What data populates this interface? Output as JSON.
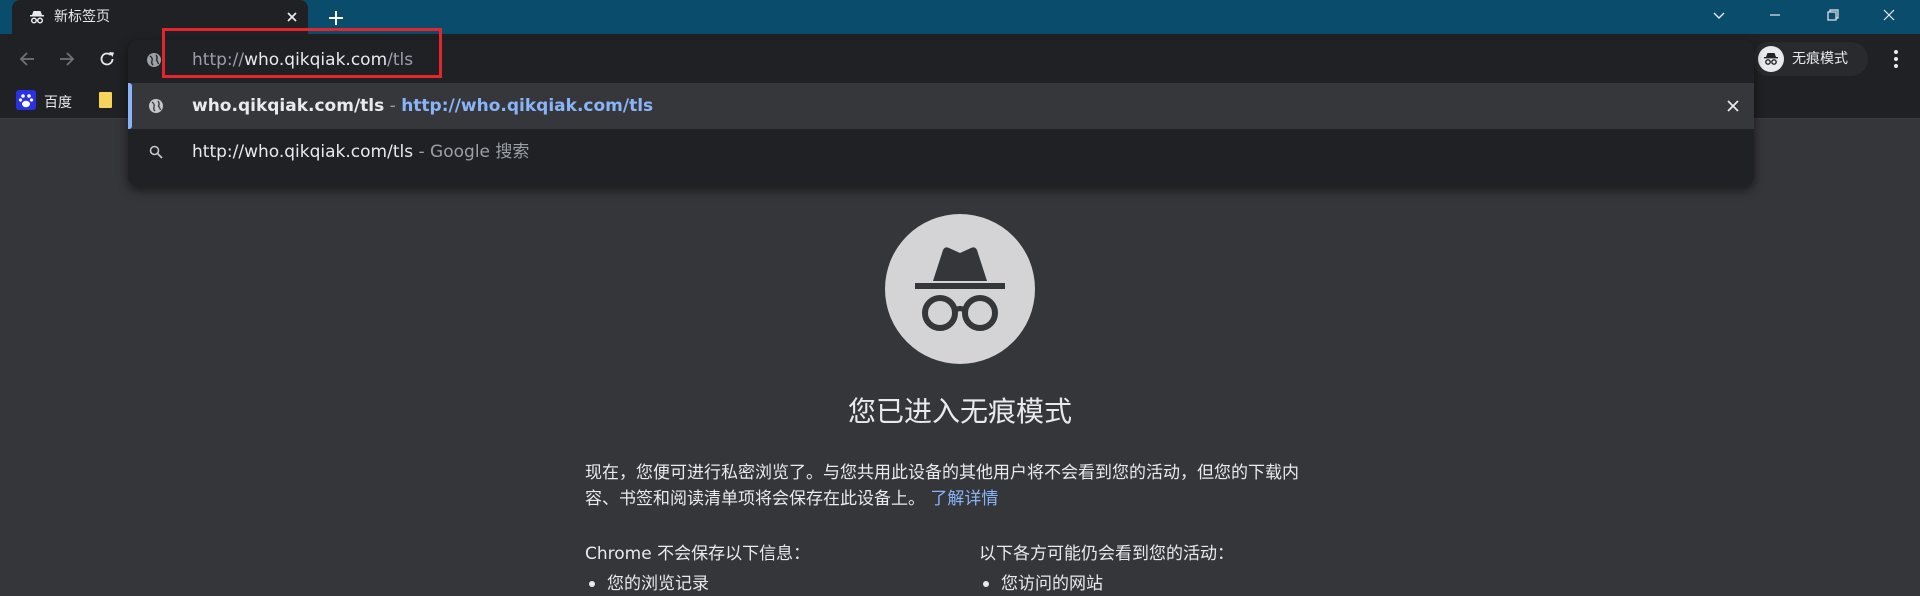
{
  "tab": {
    "title": "新标签页",
    "icon": "incognito-icon"
  },
  "toolbar": {
    "profile_label": "无痕模式"
  },
  "bookmarks": [
    {
      "label": "百度",
      "icon": "baidu-paw-icon"
    },
    {
      "label": "",
      "icon": "folder-icon"
    }
  ],
  "omnibox": {
    "input": {
      "scheme": "http://",
      "host": "who.qikqiak.com",
      "path": "/tls"
    },
    "suggestions": [
      {
        "text": "who.qikqiak.com/tls",
        "separator": " - ",
        "url": "http://who.qikqiak.com/tls",
        "icon": "globe-icon"
      },
      {
        "text": "http://who.qikqiak.com/tls",
        "separator": " - ",
        "hint": "Google 搜索",
        "icon": "search-icon"
      }
    ]
  },
  "incognito": {
    "heading": "您已进入无痕模式",
    "description_line1": "现在，您便可进行私密浏览了。与您共用此设备的其他用户将不会看到您的活动，但您的下载内",
    "description_line2": "容、书签和阅读清单项将会保存在此设备上。",
    "learn_more": "了解详情",
    "left_heading": "Chrome 不会保存以下信息：",
    "left_items": [
      "您的浏览记录"
    ],
    "right_heading": "以下各方可能仍会看到您的活动：",
    "right_items": [
      "您访问的网站"
    ]
  },
  "colors": {
    "tabstrip": "#094c6c",
    "toolbar": "#202124",
    "page_bg": "#35363a",
    "link": "#8ab4f8",
    "annotation": "#e3262b"
  }
}
